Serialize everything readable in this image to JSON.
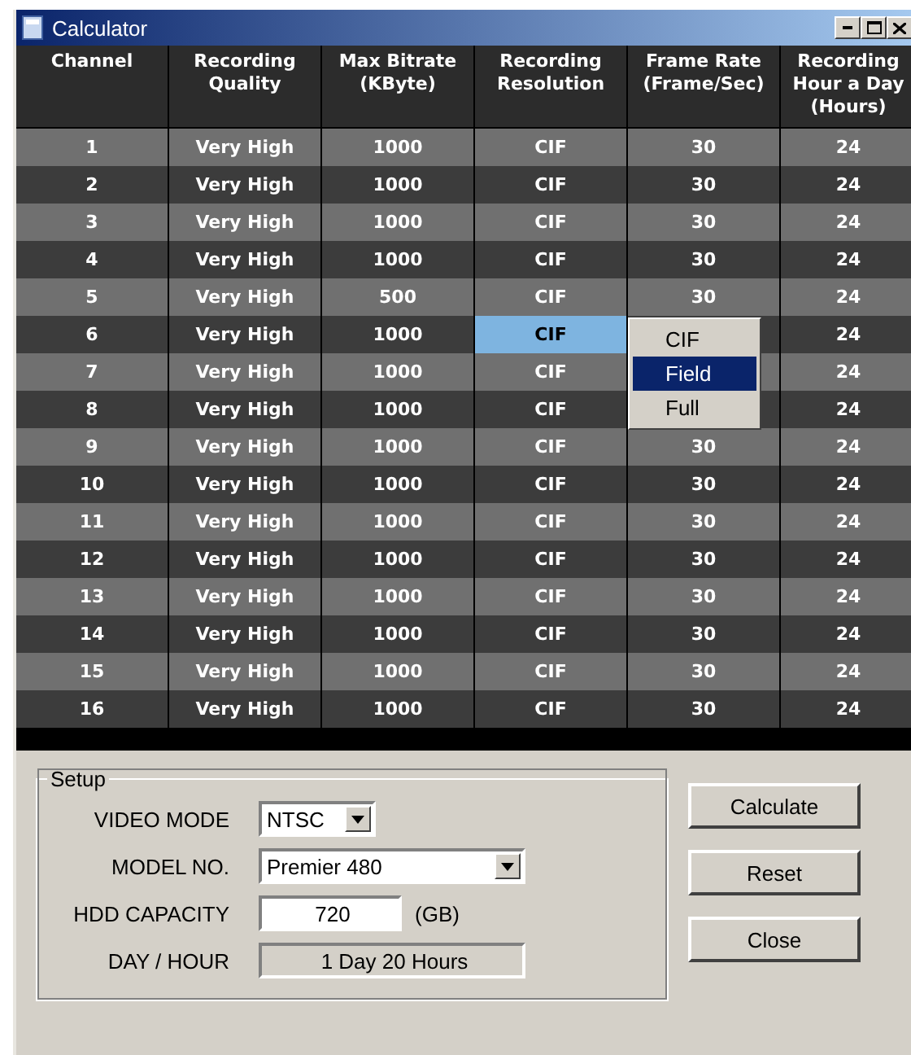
{
  "window": {
    "title": "Calculator"
  },
  "table": {
    "columns": [
      "Channel",
      "Recording Quality",
      "Max Bitrate (KByte)",
      "Recording Resolution",
      "Frame Rate (Frame/Sec)",
      "Recording Hour a Day (Hours)"
    ],
    "rows": [
      {
        "channel": "1",
        "quality": "Very High",
        "bitrate": "1000",
        "resolution": "CIF",
        "frame_rate": "30",
        "hours": "24",
        "selected": false
      },
      {
        "channel": "2",
        "quality": "Very High",
        "bitrate": "1000",
        "resolution": "CIF",
        "frame_rate": "30",
        "hours": "24",
        "selected": false
      },
      {
        "channel": "3",
        "quality": "Very High",
        "bitrate": "1000",
        "resolution": "CIF",
        "frame_rate": "30",
        "hours": "24",
        "selected": false
      },
      {
        "channel": "4",
        "quality": "Very High",
        "bitrate": "1000",
        "resolution": "CIF",
        "frame_rate": "30",
        "hours": "24",
        "selected": false
      },
      {
        "channel": "5",
        "quality": "Very High",
        "bitrate": "500",
        "resolution": "CIF",
        "frame_rate": "30",
        "hours": "24",
        "selected": false
      },
      {
        "channel": "6",
        "quality": "Very High",
        "bitrate": "1000",
        "resolution": "CIF",
        "hours": "24",
        "selected": true
      },
      {
        "channel": "7",
        "quality": "Very High",
        "bitrate": "1000",
        "resolution": "CIF",
        "hours": "24",
        "selected": false
      },
      {
        "channel": "8",
        "quality": "Very High",
        "bitrate": "1000",
        "resolution": "CIF",
        "hours": "24",
        "selected": false
      },
      {
        "channel": "9",
        "quality": "Very High",
        "bitrate": "1000",
        "resolution": "CIF",
        "frame_rate": "30",
        "hours": "24",
        "selected": false
      },
      {
        "channel": "10",
        "quality": "Very High",
        "bitrate": "1000",
        "resolution": "CIF",
        "frame_rate": "30",
        "hours": "24",
        "selected": false
      },
      {
        "channel": "11",
        "quality": "Very High",
        "bitrate": "1000",
        "resolution": "CIF",
        "frame_rate": "30",
        "hours": "24",
        "selected": false
      },
      {
        "channel": "12",
        "quality": "Very High",
        "bitrate": "1000",
        "resolution": "CIF",
        "frame_rate": "30",
        "hours": "24",
        "selected": false
      },
      {
        "channel": "13",
        "quality": "Very High",
        "bitrate": "1000",
        "resolution": "CIF",
        "frame_rate": "30",
        "hours": "24",
        "selected": false
      },
      {
        "channel": "14",
        "quality": "Very High",
        "bitrate": "1000",
        "resolution": "CIF",
        "frame_rate": "30",
        "hours": "24",
        "selected": false
      },
      {
        "channel": "15",
        "quality": "Very High",
        "bitrate": "1000",
        "resolution": "CIF",
        "frame_rate": "30",
        "hours": "24",
        "selected": false
      },
      {
        "channel": "16",
        "quality": "Very High",
        "bitrate": "1000",
        "resolution": "CIF",
        "frame_rate": "30",
        "hours": "24",
        "selected": false
      }
    ]
  },
  "resolution_dropdown": {
    "options": [
      {
        "label": "CIF",
        "selected": false
      },
      {
        "label": "Field",
        "selected": true
      },
      {
        "label": "Full",
        "selected": false
      }
    ]
  },
  "setup": {
    "title": "Setup",
    "fields": [
      {
        "kind": "select",
        "label": "VIDEO MODE",
        "value": "NTSC"
      },
      {
        "kind": "select",
        "label": "MODEL NO.",
        "value": "Premier 480"
      },
      {
        "kind": "input",
        "label": "HDD CAPACITY",
        "value": "720",
        "unit": "(GB)"
      },
      {
        "kind": "readonly",
        "label": "DAY / HOUR",
        "value": "1 Day 20 Hours"
      }
    ]
  },
  "buttons": [
    "Calculate",
    "Reset",
    "Close"
  ]
}
